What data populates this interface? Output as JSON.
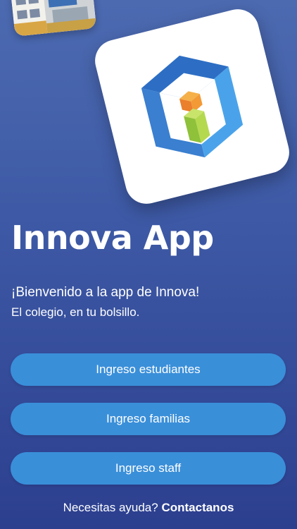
{
  "app": {
    "title": "Innova App",
    "welcome": "¡Bienvenido a la app de Innova!",
    "tagline": "El colegio, en tu bolsillo."
  },
  "buttons": {
    "students": "Ingreso estudiantes",
    "families": "Ingreso familias",
    "staff": "Ingreso staff"
  },
  "help": {
    "prompt": "Necesitas ayuda?",
    "contact": "Contactanos"
  },
  "colors": {
    "background_top": "#4c6ab0",
    "background_bottom": "#2c3f8f",
    "button": "#3a8fd9",
    "logo_blue": "#3b86d8",
    "logo_orange": "#f0923a",
    "logo_green": "#a6cf3f"
  },
  "icons": {
    "logo": "innova-cube-logo",
    "photo": "school-building-photo"
  }
}
